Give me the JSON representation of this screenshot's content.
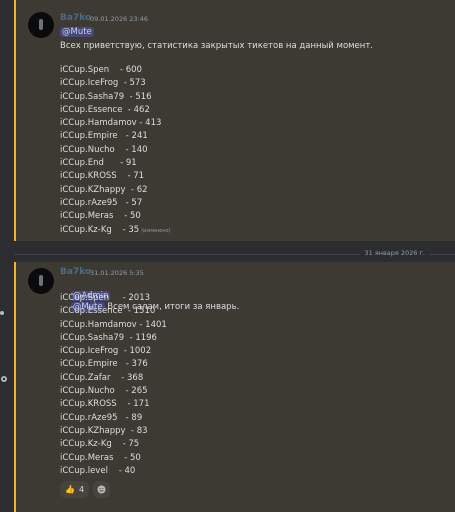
{
  "messages": [
    {
      "author": "Ba7ko",
      "timestamp": "09.01.2026 23:46",
      "mention": "@Mute",
      "intro": "Всех приветствую, статистика закрытых тикетов на данный момент.",
      "lines": [
        "iCCup.Spen    - 600",
        "iCCup.IceFrog  - 573",
        "iCCup.Sasha79  - 516",
        "iCCup.Essence  - 462",
        "iCCup.Hamdamov - 413",
        "iCCup.Empire   - 241",
        "iCCup.Nucho    - 140",
        "iCCup.End      - 91",
        "iCCup.KROSS    - 71",
        "iCCup.KZhappy  - 62",
        "iCCup.rAze95   - 57",
        "iCCup.Meras    - 50",
        "iCCup.Kz-Kg    - 35"
      ],
      "edited_label": "(изменено)"
    },
    {
      "author": "Ba7ko",
      "timestamp": "31.01.2026 5:35",
      "mention_admin": "@Admin",
      "mention_mute": "@Mute",
      "intro": " Всем салам, итоги за январь.",
      "lines": [
        "iCCup.Spen     - 2013",
        "iCCup.Essence  - 1510",
        "iCCup.Hamdamov - 1401",
        "iCCup.Sasha79  - 1196",
        "iCCup.IceFrog  - 1002",
        "iCCup.Empire   - 376",
        "iCCup.Zafar    - 368",
        "iCCup.Nucho    - 265",
        "iCCup.KROSS    - 171",
        "iCCup.rAze95   - 89",
        "iCCup.KZhappy  - 83",
        "iCCup.Kz-Kg    - 75",
        "iCCup.Meras    - 50",
        "iCCup.level    - 40"
      ],
      "reaction": {
        "emoji": "👍",
        "count": "4"
      }
    }
  ],
  "divider_date": "31 января 2026 г.",
  "colors": {
    "accent": "#f0b232",
    "highlight_bg": "#3c3a33",
    "mention": "#5865f2"
  },
  "icons": [
    "avatar",
    "thumbs-up-icon",
    "add-reaction-icon",
    "gear-icon"
  ]
}
